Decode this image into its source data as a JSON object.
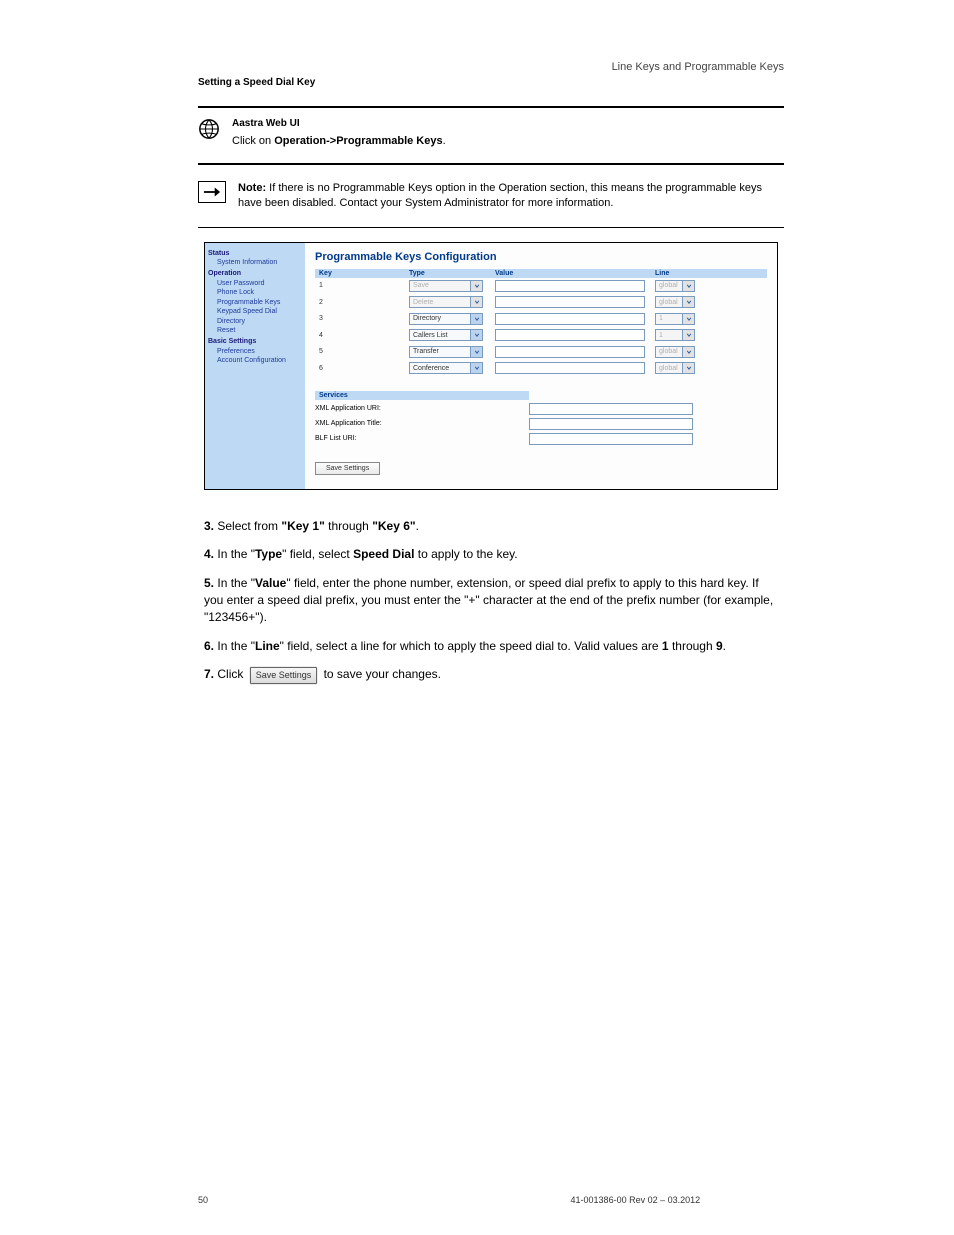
{
  "header": {
    "section_label": "Line Keys and Programmable Keys",
    "subsection": "Setting a Speed Dial Key",
    "globe_note": "Click on Operation->Programmable Keys.",
    "arrow_note_bold": "Note:",
    "arrow_note_text": "If there is no Programmable Keys option in the Operation section, this means the programmable keys have been disabled. Contact your System Administrator for more information."
  },
  "sidebar": {
    "status": "Status",
    "system_info": "System Information",
    "operation": "Operation",
    "items": [
      "User Password",
      "Phone Lock",
      "Programmable Keys",
      "Keypad Speed Dial",
      "Directory",
      "Reset"
    ],
    "basic_settings": "Basic Settings",
    "basic_items": [
      "Preferences",
      "Account Configuration"
    ]
  },
  "content": {
    "title": "Programmable Keys Configuration",
    "th_key": "Key",
    "th_type": "Type",
    "th_value": "Value",
    "th_line": "Line",
    "rows": [
      {
        "key": "1",
        "type": "Save",
        "type_disabled": true,
        "line": "global",
        "line_disabled": true
      },
      {
        "key": "2",
        "type": "Delete",
        "type_disabled": true,
        "line": "global",
        "line_disabled": true
      },
      {
        "key": "3",
        "type": "Directory",
        "type_disabled": false,
        "line": "1",
        "line_disabled": true
      },
      {
        "key": "4",
        "type": "Callers List",
        "type_disabled": false,
        "line": "1",
        "line_disabled": true
      },
      {
        "key": "5",
        "type": "Transfer",
        "type_disabled": false,
        "line": "global",
        "line_disabled": true
      },
      {
        "key": "6",
        "type": "Conference",
        "type_disabled": false,
        "line": "global",
        "line_disabled": true
      }
    ],
    "services_hdr": "Services",
    "xml_app_uri": "XML Application URI:",
    "xml_app_title": "XML Application Title:",
    "blf_list_uri": "BLF List URI:",
    "save_settings": "Save Settings"
  },
  "steps": {
    "s3_label": "3.",
    "s3_text_a": "Select from ",
    "s3_key": "\"Key 1\"",
    "s3_text_b": " through ",
    "s3_key2": "\"Key 6\"",
    "s4_label": "4.",
    "s4_text_a": "In the \"",
    "s4_type": "Type",
    "s4_text_b": "\" field, select ",
    "s4_val": "Speed Dial",
    "s4_text_c": " to apply to the key.",
    "s5_label": "5.",
    "s5_text_a": "In the \"",
    "s5_value": "Value",
    "s5_text_b": "\" field, enter the phone number, extension, or speed dial prefix to apply to this hard key. If you enter a speed dial prefix, you must enter the \"+\" character at the end of the prefix number (for example, \"123456+\").",
    "s6_label": "6.",
    "s6_text_a": "In the \"",
    "s6_line": "Line",
    "s6_text_b": "\" field, select a line for which to apply the speed dial to. Valid values are ",
    "s6_v1": "1",
    "s6_text_c": " through ",
    "s6_v2": "9",
    "s7_label": "7.",
    "s7_text_a": "Click ",
    "s7_btn": "Save Settings",
    "s7_text_b": " to save your changes."
  },
  "footer": {
    "pg": "50",
    "guide": "41-001386-00 Rev 02 – 03.2012"
  }
}
